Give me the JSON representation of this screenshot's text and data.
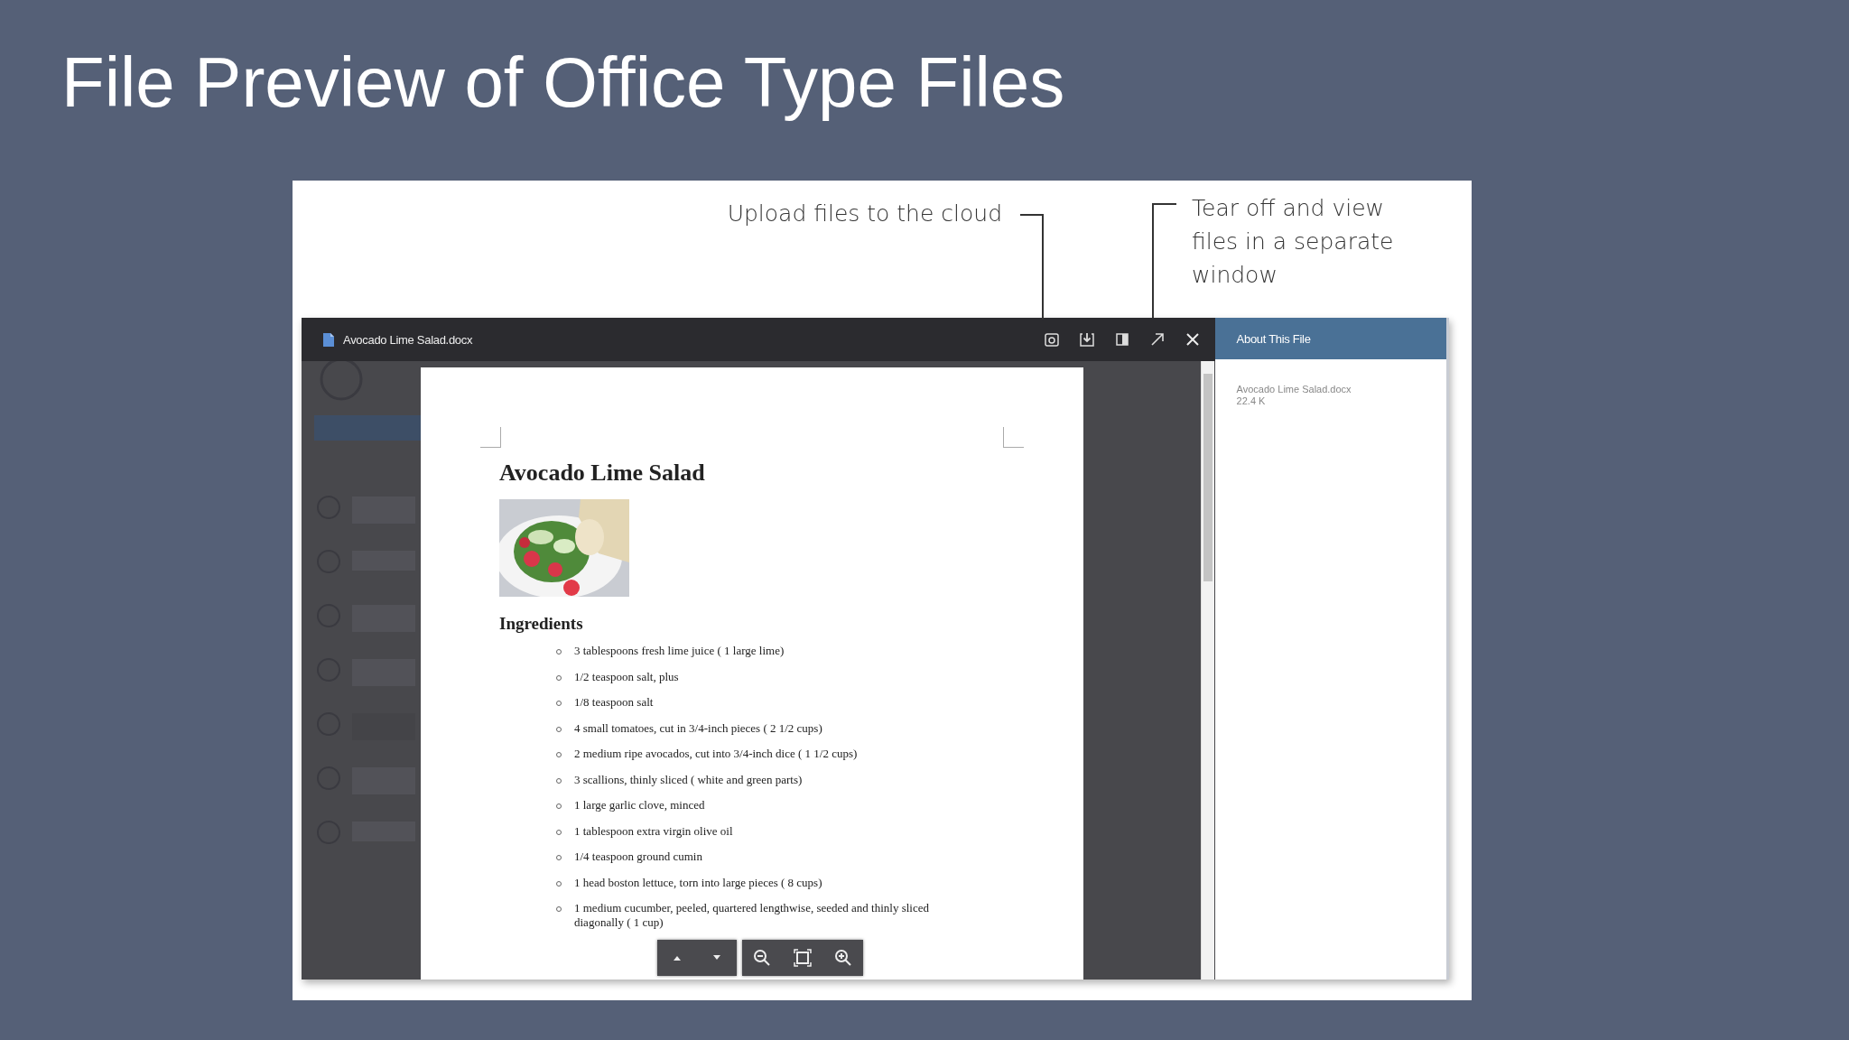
{
  "slide": {
    "title": "File Preview of Office Type Files"
  },
  "annotations": [
    {
      "text": "Upload files to the cloud",
      "kind": "left"
    },
    {
      "text": "Tear off and view files in a separate window",
      "kind": "right"
    }
  ],
  "window": {
    "title": "Avocado Lime Salad.docx"
  },
  "document": {
    "heading": "Avocado Lime Salad",
    "subheading": "Ingredients",
    "items": [
      "3 tablespoons fresh lime juice ( 1 large lime)",
      "1/2 teaspoon salt, plus",
      "1/8 teaspoon salt",
      "4 small tomatoes, cut in 3/4-inch pieces ( 2 1/2 cups)",
      "2 medium ripe avocados, cut into 3/4-inch dice ( 1 1/2 cups)",
      "3 scallions, thinly sliced ( white and green parts)",
      "1 large garlic clove, minced",
      "1 tablespoon extra virgin olive oil",
      "1/4 teaspoon ground cumin",
      "1 head boston lettuce, torn into large pieces ( 8 cups)",
      "1 medium cucumber, peeled, quartered lengthwise, seeded and thinly sliced diagonally ( 1 cup)"
    ]
  },
  "side_panel": {
    "title": "About This File",
    "file_name": "Avocado Lime Salad.docx",
    "file_size": "22.4 K"
  }
}
